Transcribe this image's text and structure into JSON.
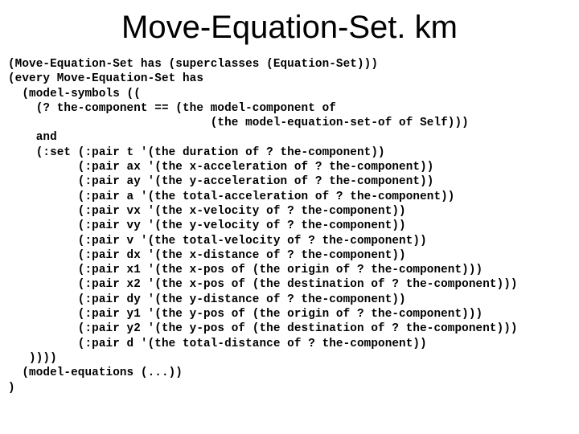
{
  "title": "Move-Equation-Set. km",
  "code": [
    "(Move-Equation-Set has (superclasses (Equation-Set)))",
    "(every Move-Equation-Set has",
    "  (model-symbols ((",
    "    (? the-component == (the model-component of",
    "                             (the model-equation-set-of of Self)))",
    "    and",
    "    (:set (:pair t '(the duration of ? the-component))",
    "          (:pair ax '(the x-acceleration of ? the-component))",
    "          (:pair ay '(the y-acceleration of ? the-component))",
    "          (:pair a '(the total-acceleration of ? the-component))",
    "          (:pair vx '(the x-velocity of ? the-component))",
    "          (:pair vy '(the y-velocity of ? the-component))",
    "          (:pair v '(the total-velocity of ? the-component))",
    "          (:pair dx '(the x-distance of ? the-component))",
    "          (:pair x1 '(the x-pos of (the origin of ? the-component)))",
    "          (:pair x2 '(the x-pos of (the destination of ? the-component)))",
    "          (:pair dy '(the y-distance of ? the-component))",
    "          (:pair y1 '(the y-pos of (the origin of ? the-component)))",
    "          (:pair y2 '(the y-pos of (the destination of ? the-component)))",
    "          (:pair d '(the total-distance of ? the-component))",
    "   ))))",
    "  (model-equations (...))",
    ")"
  ]
}
